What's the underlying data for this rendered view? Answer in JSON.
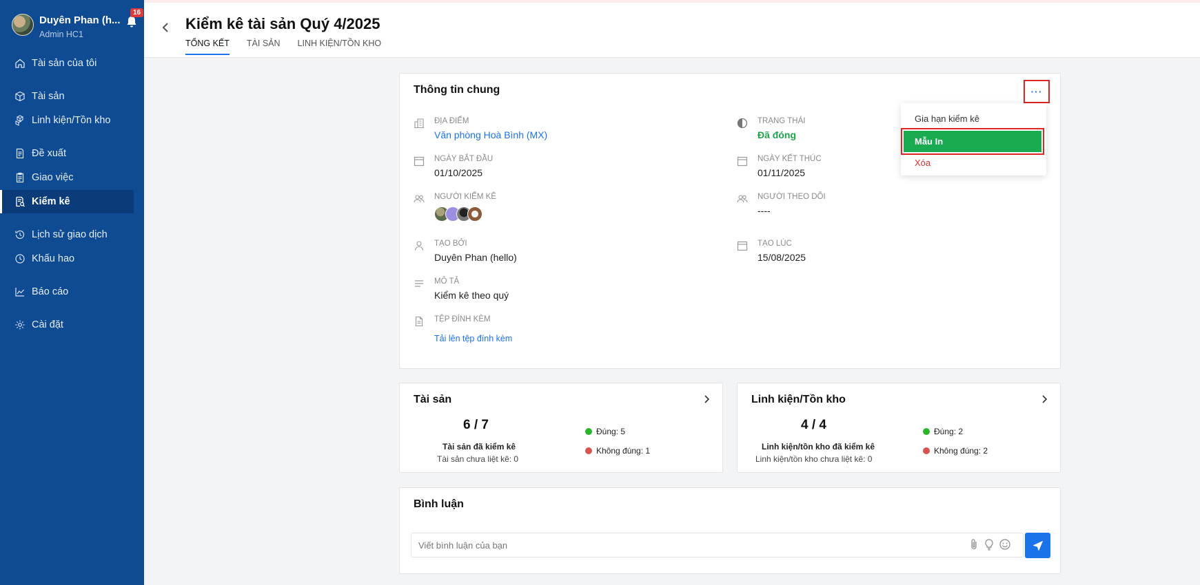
{
  "user": {
    "name": "Duyên Phan (h...",
    "role": "Admin HC1",
    "notifications": "16"
  },
  "sidebar": {
    "items": [
      {
        "label": "Tài sản của tôi",
        "icon": "home-icon"
      },
      {
        "label": "Tài sản",
        "icon": "box-icon"
      },
      {
        "label": "Linh kiện/Tồn kho",
        "icon": "boxes-icon"
      },
      {
        "label": "Đề xuất",
        "icon": "document-icon"
      },
      {
        "label": "Giao việc",
        "icon": "clipboard-icon"
      },
      {
        "label": "Kiểm kê",
        "icon": "audit-icon",
        "active": true
      },
      {
        "label": "Lịch sử giao dịch",
        "icon": "history-icon"
      },
      {
        "label": "Khấu hao",
        "icon": "clock-icon"
      },
      {
        "label": "Báo cáo",
        "icon": "chart-icon"
      },
      {
        "label": "Cài đặt",
        "icon": "gear-icon"
      }
    ]
  },
  "header": {
    "title": "Kiểm kê tài sản Quý 4/2025",
    "tabs": [
      "TỔNG KẾT",
      "TÀI SẢN",
      "LINH KIỆN/TỒN KHO"
    ]
  },
  "info": {
    "title": "Thông tin chung",
    "more": "···",
    "location_label": "ĐỊA ĐIỂM",
    "location_value": "Văn phòng Hoà Bình (MX)",
    "status_label": "TRẠNG THÁI",
    "status_value": "Đã đóng",
    "start_label": "NGÀY BẮT ĐẦU",
    "start_value": "01/10/2025",
    "end_label": "NGÀY KẾT THÚC",
    "end_value": "01/11/2025",
    "auditors_label": "NGƯỜI KIỂM KÊ",
    "followers_label": "NGƯỜI THEO DÕI",
    "followers_value": "----",
    "created_by_label": "TẠO BỞI",
    "created_by_value": "Duyên Phan (hello)",
    "created_at_label": "TẠO LÚC",
    "created_at_value": "15/08/2025",
    "description_label": "MÔ TẢ",
    "description_value": "Kiểm kê theo quý",
    "attachments_label": "TỆP ĐÍNH KÈM",
    "upload_link": "Tải lên tệp đính kèm"
  },
  "dropdown": {
    "extend": "Gia hạn kiểm kê",
    "print_template": "Mẫu In",
    "delete": "Xóa"
  },
  "assets": {
    "title": "Tài sản",
    "ratio": "6 / 7",
    "checked_label": "Tài sản đã kiểm kê",
    "unlisted_label": "Tài sản chưa liệt kê: 0",
    "correct": "Đúng: 5",
    "incorrect": "Không đúng: 1"
  },
  "components": {
    "title": "Linh kiện/Tồn kho",
    "ratio": "4 / 4",
    "checked_label": "Linh kiện/tồn kho đã kiểm kê",
    "unlisted_label": "Linh kiện/tồn kho chưa liệt kê: 0",
    "correct": "Đúng: 2",
    "incorrect": "Không đúng: 2"
  },
  "comments": {
    "title": "Bình luận",
    "placeholder": "Viết bình luận của bạn"
  },
  "colors": {
    "sidebar": "#0f4b93",
    "accent": "#1a73e8",
    "status_green": "#1fa34a",
    "menu_green": "#1aaa4f",
    "highlight_red": "#e02424",
    "delete_red": "#d32f2f",
    "dot_green": "#2ab52a",
    "dot_red": "#d9534f"
  }
}
